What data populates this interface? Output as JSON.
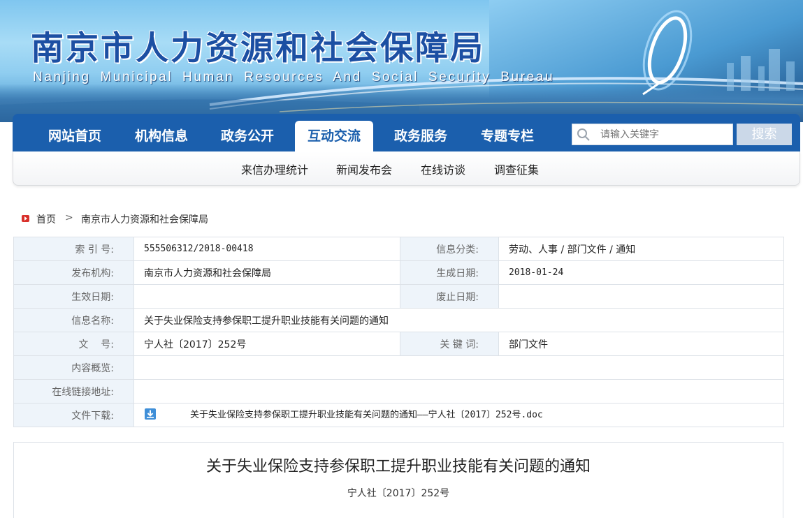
{
  "header": {
    "title_cn": "南京市人力资源和社会保障局",
    "title_en": "Nanjing Municipal Human Resources And Social Security Bureau"
  },
  "nav": {
    "items": [
      {
        "label": "网站首页"
      },
      {
        "label": "机构信息"
      },
      {
        "label": "政务公开"
      },
      {
        "label": "互动交流",
        "active": true
      },
      {
        "label": "政务服务"
      },
      {
        "label": "专题专栏"
      }
    ],
    "search_placeholder": "请输入关键字",
    "search_button": "搜索",
    "colors": {
      "nav_bg": "#1b5fad",
      "active_text": "#1b5fad"
    }
  },
  "subnav": {
    "items": [
      {
        "label": "来信办理统计"
      },
      {
        "label": "新闻发布会"
      },
      {
        "label": "在线访谈"
      },
      {
        "label": "调查征集"
      }
    ]
  },
  "breadcrumb": {
    "home": "首页",
    "separator": ">",
    "current": "南京市人力资源和社会保障局"
  },
  "info": {
    "index_no_label": "索 引 号:",
    "index_no": "555506312/2018-00418",
    "category_label": "信息分类:",
    "category": "劳动、人事 / 部门文件 / 通知",
    "publisher_label": "发布机构:",
    "publisher": "南京市人力资源和社会保障局",
    "created_label": "生成日期:",
    "created": "2018-01-24",
    "effective_label": "生效日期:",
    "effective": "",
    "expiry_label": "废止日期:",
    "expiry": "",
    "name_label": "信息名称:",
    "name": "关于失业保险支持参保职工提升职业技能有关问题的通知",
    "doc_no_label": "文    号:",
    "doc_no": "宁人社〔2017〕252号",
    "keywords_label": "关 键 词:",
    "keywords": "部门文件",
    "summary_label": "内容概览:",
    "summary": "",
    "link_label": "在线链接地址:",
    "link": "",
    "download_label": "文件下载:",
    "download_file": "关于失业保险支持参保职工提升职业技能有关问题的通知——宁人社〔2017〕252号.doc"
  },
  "article": {
    "title": "关于失业保险支持参保职工提升职业技能有关问题的通知",
    "doc_no": "宁人社〔2017〕252号"
  }
}
